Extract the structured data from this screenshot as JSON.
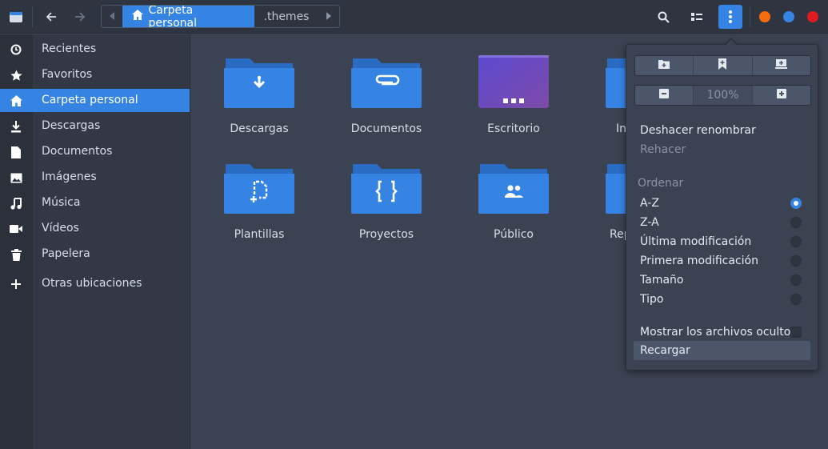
{
  "header": {
    "app_icon": "folder-window-icon",
    "back_icon": "arrow-left-icon",
    "forward_icon": "arrow-right-icon",
    "path_left_icon": "chevron-left-icon",
    "path_right_icon": "chevron-right-icon",
    "breadcrumb": [
      {
        "label": "Carpeta personal",
        "icon": "home-icon",
        "active": true
      },
      {
        "label": ".themes",
        "active": false
      }
    ],
    "search_icon": "search-icon",
    "view_icon": "list-view-icon",
    "menu_icon": "kebab-menu-icon",
    "window_controls": [
      {
        "name": "minimize",
        "color": "#f66b0e"
      },
      {
        "name": "maximize",
        "color": "#3584e4"
      },
      {
        "name": "close",
        "color": "#e01b24"
      }
    ]
  },
  "sidebar": {
    "items": [
      {
        "label": "Recientes",
        "icon": "clock-icon"
      },
      {
        "label": "Favoritos",
        "icon": "star-icon"
      },
      {
        "label": "Carpeta personal",
        "icon": "home-icon",
        "active": true
      },
      {
        "label": "Descargas",
        "icon": "download-icon"
      },
      {
        "label": "Documentos",
        "icon": "document-icon"
      },
      {
        "label": "Imágenes",
        "icon": "image-icon"
      },
      {
        "label": "Música",
        "icon": "music-icon"
      },
      {
        "label": "Vídeos",
        "icon": "video-icon"
      },
      {
        "label": "Papelera",
        "icon": "trash-icon"
      },
      {
        "label": "Otras ubicaciones",
        "icon": "plus-icon"
      }
    ]
  },
  "files": [
    {
      "label": "Descargas",
      "icon": "download-folder-icon"
    },
    {
      "label": "Documentos",
      "icon": "attachment-folder-icon"
    },
    {
      "label": "Escritorio",
      "icon": "desktop-folder-icon"
    },
    {
      "label": "In",
      "icon": "folder-icon"
    },
    {
      "label": "Plantillas",
      "icon": "template-folder-icon"
    },
    {
      "label": "Proyectos",
      "icon": "braces-folder-icon"
    },
    {
      "label": "Público",
      "icon": "people-folder-icon"
    },
    {
      "label": "Rep",
      "icon": "folder-icon"
    }
  ],
  "colors": {
    "accent": "#3584e4",
    "folder": "#3584e4",
    "folder_dark": "#2a6bc4"
  },
  "popover": {
    "action_icons": [
      "new-folder-icon",
      "bookmark-add-icon",
      "new-tab-icon"
    ],
    "zoom_out_icon": "minus-icon",
    "zoom_in_icon": "plus-icon",
    "zoom_level": "100%",
    "undo_label": "Deshacer renombrar",
    "redo_label": "Rehacer",
    "sort_heading": "Ordenar",
    "sort_options": [
      {
        "label": "A-Z",
        "selected": true
      },
      {
        "label": "Z-A",
        "selected": false
      },
      {
        "label": "Última modificación",
        "selected": false
      },
      {
        "label": "Primera modificación",
        "selected": false
      },
      {
        "label": "Tamaño",
        "selected": false
      },
      {
        "label": "Tipo",
        "selected": false
      }
    ],
    "hidden_files_label": "Mostrar los archivos ocultos",
    "hidden_files_checked": false,
    "reload_label": "Recargar"
  }
}
